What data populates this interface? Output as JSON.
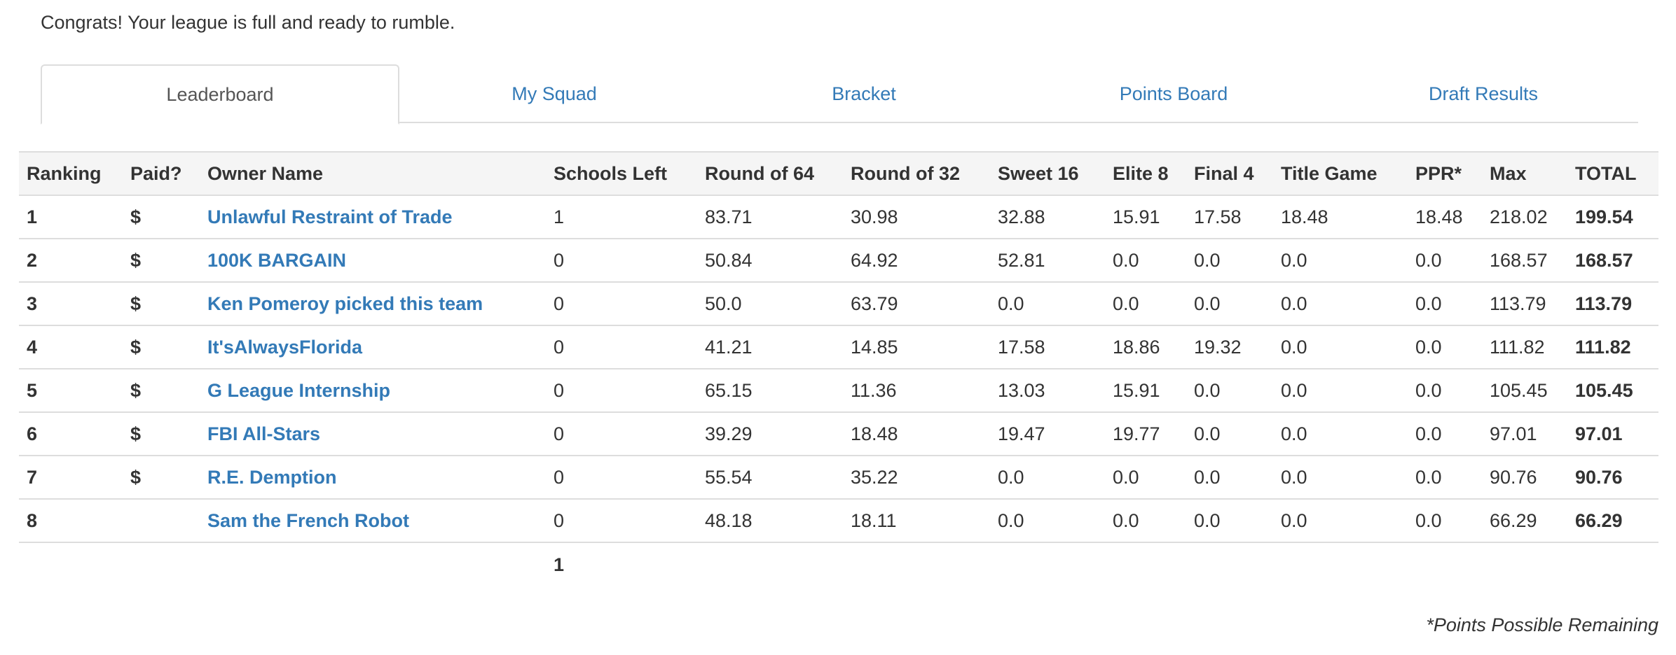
{
  "message": "Congrats! Your league is full and ready to rumble.",
  "tabs": [
    {
      "label": "Leaderboard",
      "active": true
    },
    {
      "label": "My Squad",
      "active": false
    },
    {
      "label": "Bracket",
      "active": false
    },
    {
      "label": "Points Board",
      "active": false
    },
    {
      "label": "Draft Results",
      "active": false
    }
  ],
  "table": {
    "headers": [
      "Ranking",
      "Paid?",
      "Owner Name",
      "Schools Left",
      "Round of 64",
      "Round of 32",
      "Sweet 16",
      "Elite 8",
      "Final 4",
      "Title Game",
      "PPR*",
      "Max",
      "TOTAL"
    ],
    "rows": [
      {
        "ranking": "1",
        "paid": "$",
        "owner": "Unlawful Restraint of Trade",
        "schools_left": "1",
        "r64": "83.71",
        "r32": "30.98",
        "s16": "32.88",
        "e8": "15.91",
        "f4": "17.58",
        "title": "18.48",
        "ppr": "18.48",
        "max": "218.02",
        "total": "199.54"
      },
      {
        "ranking": "2",
        "paid": "$",
        "owner": "100K BARGAIN",
        "schools_left": "0",
        "r64": "50.84",
        "r32": "64.92",
        "s16": "52.81",
        "e8": "0.0",
        "f4": "0.0",
        "title": "0.0",
        "ppr": "0.0",
        "max": "168.57",
        "total": "168.57"
      },
      {
        "ranking": "3",
        "paid": "$",
        "owner": "Ken Pomeroy picked this team",
        "schools_left": "0",
        "r64": "50.0",
        "r32": "63.79",
        "s16": "0.0",
        "e8": "0.0",
        "f4": "0.0",
        "title": "0.0",
        "ppr": "0.0",
        "max": "113.79",
        "total": "113.79"
      },
      {
        "ranking": "4",
        "paid": "$",
        "owner": "It'sAlwaysFlorida",
        "schools_left": "0",
        "r64": "41.21",
        "r32": "14.85",
        "s16": "17.58",
        "e8": "18.86",
        "f4": "19.32",
        "title": "0.0",
        "ppr": "0.0",
        "max": "111.82",
        "total": "111.82"
      },
      {
        "ranking": "5",
        "paid": "$",
        "owner": "G League Internship",
        "schools_left": "0",
        "r64": "65.15",
        "r32": "11.36",
        "s16": "13.03",
        "e8": "15.91",
        "f4": "0.0",
        "title": "0.0",
        "ppr": "0.0",
        "max": "105.45",
        "total": "105.45"
      },
      {
        "ranking": "6",
        "paid": "$",
        "owner": "FBI All-Stars",
        "schools_left": "0",
        "r64": "39.29",
        "r32": "18.48",
        "s16": "19.47",
        "e8": "19.77",
        "f4": "0.0",
        "title": "0.0",
        "ppr": "0.0",
        "max": "97.01",
        "total": "97.01"
      },
      {
        "ranking": "7",
        "paid": "$",
        "owner": "R.E. Demption",
        "schools_left": "0",
        "r64": "55.54",
        "r32": "35.22",
        "s16": "0.0",
        "e8": "0.0",
        "f4": "0.0",
        "title": "0.0",
        "ppr": "0.0",
        "max": "90.76",
        "total": "90.76"
      },
      {
        "ranking": "8",
        "paid": "",
        "owner": "Sam the French Robot",
        "schools_left": "0",
        "r64": "48.18",
        "r32": "18.11",
        "s16": "0.0",
        "e8": "0.0",
        "f4": "0.0",
        "title": "0.0",
        "ppr": "0.0",
        "max": "66.29",
        "total": "66.29"
      }
    ],
    "schools_left_total": "1"
  },
  "footnote": "*Points Possible Remaining",
  "colors": {
    "link": "#337ab7",
    "text": "#333333",
    "header_bg": "#f5f5f5",
    "border": "#dddddd"
  }
}
